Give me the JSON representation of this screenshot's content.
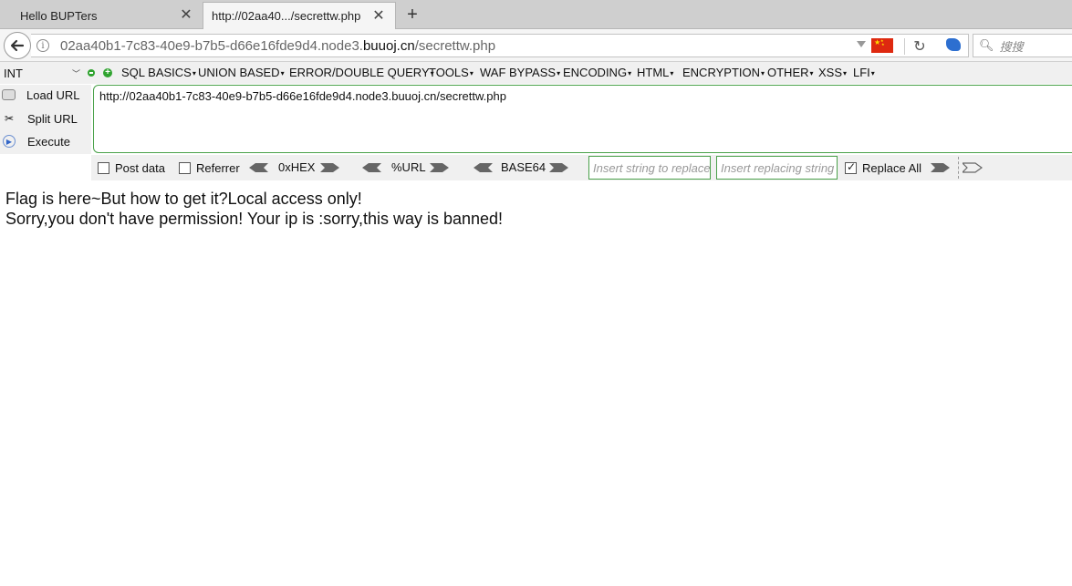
{
  "tabs": [
    {
      "label": "Hello BUPTers",
      "active": false
    },
    {
      "label": "http://02aa40.../secrettw.php",
      "active": true
    }
  ],
  "navbar": {
    "url_prefix": "02aa40b1-7c83-40e9-b7b5-d66e16fde9d4.node3.",
    "url_domain": "buuoj.cn",
    "url_path": "/secrettw.php",
    "search_placeholder": "搜搜"
  },
  "hackbar": {
    "int_select": "INT",
    "menus": [
      "SQL BASICS",
      "UNION BASED",
      "ERROR/DOUBLE QUERY",
      "TOOLS",
      "WAF BYPASS",
      "ENCODING",
      "HTML",
      "ENCRYPTION",
      "OTHER",
      "XSS",
      "LFI"
    ],
    "buttons": {
      "load": "Load URL",
      "split": "Split URL",
      "execute": "Execute"
    },
    "url_value": "http://02aa40b1-7c83-40e9-b7b5-d66e16fde9d4.node3.buuoj.cn/secrettw.php",
    "post_data_label": "Post data",
    "referrer_label": "Referrer",
    "encoders": [
      "0xHEX",
      "%URL",
      "BASE64"
    ],
    "insert_placeholder": "Insert string to replace",
    "replacing_placeholder": "Insert replacing string",
    "replace_all_label": "Replace All",
    "replace_all_checked": true
  },
  "page": {
    "line1": "Flag is here~But how to get it?Local access only!",
    "line2": "Sorry,you don't have permission! Your ip is :sorry,this way is banned!"
  }
}
